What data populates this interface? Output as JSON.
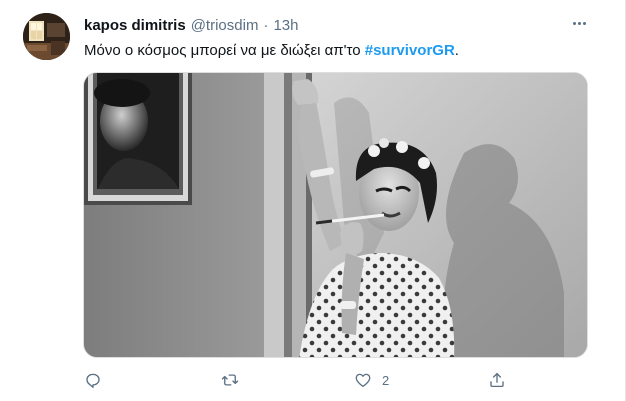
{
  "tweet": {
    "author_name": "kapos dimitris",
    "author_handle": "@triosdim",
    "separator": "·",
    "time": "13h",
    "text_prefix": "Μόνο ο κόσμος μπορεί να με διώξει απ'το ",
    "hashtag": "#survivorGR",
    "text_suffix": ".",
    "like_count": "2"
  },
  "icons": {
    "more": "more-icon",
    "reply": "reply-icon",
    "retweet": "retweet-icon",
    "like": "like-icon",
    "share": "share-icon"
  },
  "colors": {
    "text": "#0f1419",
    "secondary": "#5b7083",
    "hashtag": "#1d9bf0",
    "divider": "#e3e6e8"
  }
}
